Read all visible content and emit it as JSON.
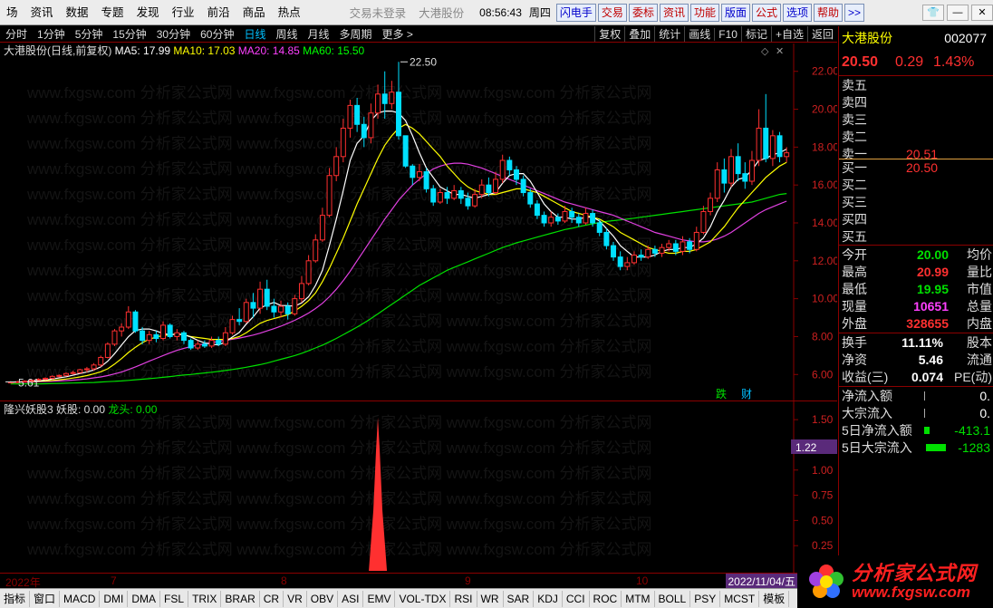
{
  "menu": {
    "items": [
      "场",
      "资讯",
      "数据",
      "专题",
      "发现",
      "行业",
      "前沿",
      "商品",
      "热点"
    ],
    "login_status": "交易未登录",
    "stock_name": "大港股份",
    "clock": "08:56:43",
    "weekday": "周四",
    "func_buttons": [
      "闪电手",
      "交易",
      "委标",
      "资讯",
      "功能",
      "版面",
      "公式",
      "选项",
      "帮助",
      ">>"
    ]
  },
  "periods": [
    "分时",
    "1分钟",
    "5分钟",
    "15分钟",
    "30分钟",
    "60分钟",
    "日线",
    "周线",
    "月线",
    "多周期",
    "更多 >"
  ],
  "active_period": "日线",
  "tools": [
    "复权",
    "叠加",
    "统计",
    "画线",
    "F10",
    "标记",
    "+自选",
    "返回"
  ],
  "chart_header": {
    "title": "大港股份(日线,前复权)",
    "ma5": "MA5: 17.99",
    "ma10": "MA10: 17.03",
    "ma20": "MA20: 14.85",
    "ma60": "MA60: 15.50"
  },
  "markers": {
    "high": "22.50",
    "low": "5.61",
    "die": "跌",
    "cai": "财"
  },
  "sub_header": {
    "name": "隆兴妖股3 妖股: 0.00",
    "longtou": "龙头: 0.00"
  },
  "sub_badge": "1.22",
  "time_axis": {
    "labels": [
      "2022年",
      "7",
      "8",
      "9",
      "10"
    ],
    "end_date": "2022/11/04/五"
  },
  "indicators": [
    "指标",
    "窗口",
    "MACD",
    "DMI",
    "DMA",
    "FSL",
    "TRIX",
    "BRAR",
    "CR",
    "VR",
    "OBV",
    "ASI",
    "EMV",
    "VOL-TDX",
    "RSI",
    "WR",
    "SAR",
    "KDJ",
    "CCI",
    "ROC",
    "MTM",
    "BOLL",
    "PSY",
    "MCST",
    "模板"
  ],
  "quote": {
    "name": "大港股份",
    "code": "002077",
    "price": "20.50",
    "change": "0.29",
    "change_pct": "1.43%",
    "sell_labels": [
      "卖五",
      "卖四",
      "卖三",
      "卖二",
      "卖一"
    ],
    "sell1_price": "20.51",
    "buy_labels": [
      "买一",
      "买二",
      "买三",
      "买四",
      "买五"
    ],
    "buy1_price": "20.50",
    "stats": [
      {
        "label": "今开",
        "value": "20.00",
        "label2": "均价"
      },
      {
        "label": "最高",
        "value": "20.99",
        "label2": "量比"
      },
      {
        "label": "最低",
        "value": "19.95",
        "label2": "市值"
      },
      {
        "label": "现量",
        "value": "10651",
        "label2": "总量"
      },
      {
        "label": "外盘",
        "value": "328655",
        "label2": "内盘"
      }
    ],
    "stats2": [
      {
        "label": "换手",
        "value": "11.11%",
        "label2": "股本"
      },
      {
        "label": "净资",
        "value": "5.46",
        "label2": "流通"
      },
      {
        "label": "收益(三)",
        "value": "0.074",
        "label2": "PE(动)"
      }
    ],
    "flows": [
      {
        "label": "净流入额",
        "value": "0."
      },
      {
        "label": "大宗流入",
        "value": "0."
      },
      {
        "label": "5日净流入额",
        "value": "-413.1"
      },
      {
        "label": "5日大宗流入",
        "value": "-1283"
      }
    ]
  },
  "logo": {
    "cn": "分析家公式网",
    "url": "www.fxgsw.com"
  },
  "chart_data": {
    "type": "candlestick",
    "y_ticks": [
      "22.00",
      "20.00",
      "18.00",
      "16.00",
      "14.00",
      "12.00",
      "10.00",
      "8.00",
      "6.00"
    ],
    "ylim": [
      5.2,
      22.8
    ],
    "sub_y_ticks": [
      "1.50",
      "1.25",
      "1.00",
      "0.75",
      "0.50",
      "0.25"
    ],
    "sub_ylim": [
      0,
      1.6
    ],
    "candles": [
      [
        5.6,
        5.6,
        5.55,
        5.65
      ],
      [
        5.6,
        5.62,
        5.58,
        5.66
      ],
      [
        5.62,
        5.65,
        5.6,
        5.7
      ],
      [
        5.65,
        5.7,
        5.62,
        5.75
      ],
      [
        5.7,
        5.75,
        5.68,
        5.8
      ],
      [
        5.75,
        5.8,
        5.7,
        5.85
      ],
      [
        5.8,
        5.9,
        5.75,
        5.95
      ],
      [
        5.9,
        5.95,
        5.85,
        6.0
      ],
      [
        5.95,
        6.05,
        5.9,
        6.1
      ],
      [
        6.05,
        6.1,
        6.0,
        6.2
      ],
      [
        6.1,
        6.25,
        6.05,
        6.3
      ],
      [
        6.25,
        6.3,
        6.1,
        6.4
      ],
      [
        6.3,
        6.5,
        6.2,
        6.6
      ],
      [
        6.5,
        6.9,
        6.4,
        7.0
      ],
      [
        6.9,
        7.6,
        6.85,
        7.7
      ],
      [
        7.6,
        8.3,
        7.5,
        8.4
      ],
      [
        8.3,
        8.5,
        8.0,
        8.7
      ],
      [
        8.5,
        9.3,
        8.4,
        9.6
      ],
      [
        9.3,
        8.3,
        8.2,
        9.4
      ],
      [
        8.3,
        7.8,
        7.6,
        8.5
      ],
      [
        7.8,
        8.1,
        7.6,
        8.3
      ],
      [
        8.1,
        7.9,
        7.7,
        8.3
      ],
      [
        7.9,
        8.6,
        7.8,
        8.8
      ],
      [
        8.6,
        8.0,
        7.9,
        8.7
      ],
      [
        8.0,
        8.2,
        7.8,
        8.4
      ],
      [
        8.2,
        7.8,
        7.6,
        8.3
      ],
      [
        7.8,
        7.4,
        7.3,
        7.9
      ],
      [
        7.4,
        7.6,
        7.3,
        7.8
      ],
      [
        7.6,
        7.5,
        7.4,
        7.8
      ],
      [
        7.5,
        7.8,
        7.4,
        8.0
      ],
      [
        7.8,
        7.6,
        7.5,
        8.0
      ],
      [
        7.6,
        8.2,
        7.5,
        8.5
      ],
      [
        8.2,
        8.9,
        8.1,
        9.1
      ],
      [
        8.9,
        8.8,
        8.6,
        9.5
      ],
      [
        8.8,
        9.8,
        8.7,
        10.0
      ],
      [
        9.8,
        9.5,
        9.0,
        10.3
      ],
      [
        9.5,
        10.5,
        9.2,
        10.9
      ],
      [
        10.5,
        9.6,
        9.4,
        11.0
      ],
      [
        9.6,
        9.3,
        9.0,
        10.0
      ],
      [
        9.3,
        9.6,
        9.0,
        9.9
      ],
      [
        9.6,
        9.2,
        8.9,
        9.8
      ],
      [
        9.2,
        10.0,
        9.1,
        10.2
      ],
      [
        10.0,
        10.8,
        9.8,
        11.2
      ],
      [
        10.8,
        12.0,
        10.7,
        12.3
      ],
      [
        12.0,
        13.1,
        11.9,
        13.4
      ],
      [
        13.1,
        14.4,
        13.0,
        14.8
      ],
      [
        14.4,
        16.5,
        14.3,
        16.9
      ],
      [
        16.5,
        17.5,
        16.2,
        18.0
      ],
      [
        17.5,
        19.0,
        17.2,
        19.5
      ],
      [
        19.0,
        20.2,
        18.5,
        20.5
      ],
      [
        20.2,
        19.2,
        18.8,
        20.6
      ],
      [
        19.2,
        18.5,
        18.0,
        19.6
      ],
      [
        18.5,
        19.8,
        18.2,
        20.3
      ],
      [
        19.8,
        20.8,
        19.5,
        21.3
      ],
      [
        20.8,
        20.3,
        19.5,
        22.0
      ],
      [
        20.3,
        20.9,
        20.0,
        21.5
      ],
      [
        20.9,
        18.6,
        18.4,
        22.5
      ],
      [
        18.6,
        17.0,
        16.9,
        18.6
      ],
      [
        17.0,
        16.4,
        16.0,
        17.1
      ],
      [
        16.4,
        16.7,
        16.2,
        17.1
      ],
      [
        16.7,
        15.8,
        15.6,
        16.9
      ],
      [
        15.8,
        15.1,
        14.9,
        16.0
      ],
      [
        15.1,
        15.6,
        15.0,
        15.8
      ],
      [
        15.6,
        15.3,
        15.0,
        15.9
      ],
      [
        15.3,
        15.7,
        15.2,
        16.0
      ],
      [
        15.7,
        15.3,
        15.0,
        15.9
      ],
      [
        15.3,
        14.9,
        14.7,
        15.6
      ],
      [
        14.9,
        15.5,
        14.8,
        15.8
      ],
      [
        15.5,
        16.0,
        15.3,
        16.3
      ],
      [
        16.0,
        15.6,
        15.4,
        16.4
      ],
      [
        15.6,
        16.3,
        15.5,
        16.7
      ],
      [
        16.3,
        17.3,
        16.1,
        17.6
      ],
      [
        17.3,
        16.8,
        16.5,
        17.5
      ],
      [
        16.8,
        16.3,
        16.0,
        17.0
      ],
      [
        16.3,
        15.6,
        15.4,
        16.5
      ],
      [
        15.6,
        15.0,
        14.8,
        15.8
      ],
      [
        15.0,
        14.4,
        14.2,
        15.2
      ],
      [
        14.4,
        14.0,
        13.8,
        14.6
      ],
      [
        14.0,
        14.3,
        13.8,
        14.6
      ],
      [
        14.3,
        14.1,
        13.9,
        14.5
      ],
      [
        14.1,
        14.6,
        14.0,
        14.9
      ],
      [
        14.6,
        14.3,
        14.0,
        14.8
      ],
      [
        14.3,
        14.0,
        13.8,
        14.5
      ],
      [
        14.0,
        14.5,
        13.9,
        14.8
      ],
      [
        14.5,
        14.0,
        13.8,
        14.7
      ],
      [
        14.0,
        13.5,
        13.3,
        14.2
      ],
      [
        13.5,
        12.8,
        12.6,
        13.7
      ],
      [
        12.8,
        12.2,
        12.0,
        13.0
      ],
      [
        12.2,
        11.7,
        11.5,
        12.5
      ],
      [
        11.7,
        11.9,
        11.5,
        12.2
      ],
      [
        11.9,
        12.3,
        11.8,
        12.5
      ],
      [
        12.3,
        12.2,
        12.0,
        12.6
      ],
      [
        12.2,
        12.6,
        12.1,
        12.8
      ],
      [
        12.6,
        12.4,
        12.2,
        12.8
      ],
      [
        12.4,
        12.7,
        12.2,
        12.9
      ],
      [
        12.7,
        12.9,
        12.5,
        13.1
      ],
      [
        12.9,
        12.5,
        12.3,
        13.1
      ],
      [
        12.5,
        13.0,
        12.3,
        13.3
      ],
      [
        13.0,
        12.6,
        12.4,
        13.2
      ],
      [
        12.6,
        13.5,
        12.5,
        13.8
      ],
      [
        13.5,
        14.6,
        13.4,
        14.9
      ],
      [
        14.6,
        15.3,
        14.4,
        15.6
      ],
      [
        15.3,
        16.8,
        15.1,
        17.2
      ],
      [
        16.8,
        16.1,
        15.6,
        17.4
      ],
      [
        16.1,
        17.5,
        15.9,
        17.9
      ],
      [
        17.5,
        16.6,
        16.2,
        18.2
      ],
      [
        16.6,
        16.2,
        15.8,
        17.2
      ],
      [
        16.2,
        17.3,
        16.0,
        17.8
      ],
      [
        17.3,
        19.0,
        17.0,
        20.0
      ],
      [
        19.0,
        17.4,
        17.2,
        20.8
      ],
      [
        17.4,
        18.6,
        17.0,
        18.9
      ],
      [
        18.6,
        17.5,
        17.2,
        18.8
      ],
      [
        17.5,
        17.7,
        17.2,
        18.0
      ]
    ],
    "ma5": [
      5.6,
      5.6,
      5.62,
      5.64,
      5.66,
      5.7,
      5.76,
      5.82,
      5.88,
      5.96,
      6.05,
      6.13,
      6.24,
      6.4,
      6.7,
      7.1,
      7.56,
      8.0,
      8.32,
      8.4,
      8.4,
      8.3,
      8.16,
      8.1,
      8.12,
      8.1,
      7.98,
      7.8,
      7.66,
      7.6,
      7.56,
      7.72,
      7.98,
      8.22,
      8.66,
      9.04,
      9.5,
      9.68,
      9.8,
      9.64,
      9.64,
      9.6,
      9.78,
      10.1,
      10.7,
      11.5,
      12.8,
      14.2,
      15.7,
      17.3,
      18.2,
      18.6,
      19.4,
      19.8,
      19.9,
      19.9,
      19.8,
      19.4,
      18.6,
      17.7,
      16.9,
      16.4,
      15.9,
      15.7,
      15.5,
      15.5,
      15.4,
      15.3,
      15.4,
      15.5,
      15.6,
      16.1,
      16.5,
      16.6,
      16.6,
      16.2,
      15.6,
      15.0,
      14.6,
      14.3,
      14.3,
      14.2,
      14.2,
      14.3,
      14.3,
      14.1,
      13.7,
      13.3,
      12.8,
      12.5,
      12.2,
      12.2,
      12.2,
      12.3,
      12.5,
      12.6,
      12.6,
      12.7,
      12.7,
      12.9,
      13.2,
      13.8,
      14.6,
      15.2,
      15.9,
      16.3,
      16.4,
      16.8,
      17.3,
      17.4,
      17.6,
      17.7,
      17.9
    ],
    "ma10": [
      5.6,
      5.6,
      5.61,
      5.62,
      5.64,
      5.66,
      5.69,
      5.72,
      5.76,
      5.81,
      5.87,
      5.94,
      6.03,
      6.14,
      6.3,
      6.55,
      6.84,
      7.16,
      7.44,
      7.68,
      7.86,
      7.98,
      8.05,
      8.1,
      8.15,
      8.1,
      8.0,
      7.95,
      7.9,
      7.85,
      7.85,
      7.85,
      7.9,
      8.0,
      8.2,
      8.45,
      8.7,
      8.85,
      8.95,
      9.05,
      9.15,
      9.35,
      9.6,
      9.9,
      10.3,
      10.9,
      11.6,
      12.4,
      13.2,
      14.1,
      15.0,
      15.8,
      16.6,
      17.4,
      18.1,
      18.6,
      19.0,
      19.2,
      19.0,
      18.7,
      18.3,
      17.9,
      17.5,
      17.0,
      16.6,
      16.2,
      15.9,
      15.7,
      15.6,
      15.5,
      15.5,
      15.6,
      15.7,
      15.8,
      15.8,
      15.7,
      15.6,
      15.4,
      15.2,
      15.0,
      14.8,
      14.6,
      14.5,
      14.4,
      14.3,
      14.2,
      14.0,
      13.8,
      13.5,
      13.3,
      13.1,
      12.9,
      12.7,
      12.6,
      12.5,
      12.4,
      12.4,
      12.5,
      12.5,
      12.6,
      12.8,
      13.0,
      13.4,
      13.8,
      14.3,
      14.8,
      15.2,
      15.6,
      16.0,
      16.4,
      16.7,
      17.0,
      17.2
    ],
    "ma20": [
      5.6,
      5.6,
      5.6,
      5.6,
      5.62,
      5.63,
      5.64,
      5.66,
      5.68,
      5.7,
      5.73,
      5.77,
      5.82,
      5.87,
      5.94,
      6.03,
      6.13,
      6.26,
      6.4,
      6.55,
      6.7,
      6.85,
      7.0,
      7.14,
      7.27,
      7.38,
      7.47,
      7.55,
      7.62,
      7.68,
      7.74,
      7.8,
      7.86,
      7.92,
      8.0,
      8.08,
      8.18,
      8.3,
      8.42,
      8.55,
      8.7,
      8.86,
      9.04,
      9.24,
      9.48,
      9.76,
      10.1,
      10.5,
      10.95,
      11.45,
      12.0,
      12.55,
      13.1,
      13.65,
      14.2,
      14.7,
      15.2,
      15.6,
      16.0,
      16.3,
      16.6,
      16.85,
      17.0,
      17.1,
      17.15,
      17.15,
      17.1,
      17.0,
      16.9,
      16.75,
      16.6,
      16.45,
      16.3,
      16.15,
      16.0,
      15.85,
      15.7,
      15.55,
      15.4,
      15.25,
      15.1,
      15.0,
      14.9,
      14.8,
      14.7,
      14.6,
      14.5,
      14.4,
      14.25,
      14.1,
      13.95,
      13.8,
      13.65,
      13.5,
      13.4,
      13.3,
      13.2,
      13.1,
      13.05,
      13.0,
      13.0,
      13.05,
      13.15,
      13.3,
      13.5,
      13.75,
      14.0,
      14.25,
      14.5,
      14.7,
      14.85,
      15.0,
      15.15
    ],
    "ma60": [
      5.5,
      5.5,
      5.5,
      5.5,
      5.5,
      5.51,
      5.52,
      5.53,
      5.54,
      5.55,
      5.56,
      5.57,
      5.58,
      5.6,
      5.62,
      5.64,
      5.66,
      5.69,
      5.72,
      5.75,
      5.78,
      5.81,
      5.85,
      5.89,
      5.93,
      5.97,
      6.0,
      6.04,
      6.08,
      6.12,
      6.16,
      6.21,
      6.26,
      6.32,
      6.38,
      6.45,
      6.52,
      6.6,
      6.7,
      6.8,
      6.9,
      7.0,
      7.12,
      7.25,
      7.4,
      7.55,
      7.72,
      7.9,
      8.1,
      8.3,
      8.5,
      8.72,
      8.95,
      9.2,
      9.45,
      9.7,
      9.95,
      10.2,
      10.45,
      10.7,
      10.9,
      11.1,
      11.3,
      11.5,
      11.65,
      11.8,
      11.95,
      12.1,
      12.25,
      12.4,
      12.55,
      12.7,
      12.82,
      12.95,
      13.05,
      13.15,
      13.25,
      13.35,
      13.45,
      13.55,
      13.65,
      13.72,
      13.8,
      13.88,
      13.95,
      14.02,
      14.08,
      14.12,
      14.16,
      14.2,
      14.25,
      14.3,
      14.35,
      14.4,
      14.45,
      14.5,
      14.55,
      14.6,
      14.65,
      14.7,
      14.75,
      14.8,
      14.85,
      14.9,
      14.95,
      15.0,
      15.05,
      15.1,
      15.2,
      15.3,
      15.4,
      15.5,
      15.55
    ],
    "sub_spike": {
      "index": 53,
      "value": 1.52
    }
  }
}
